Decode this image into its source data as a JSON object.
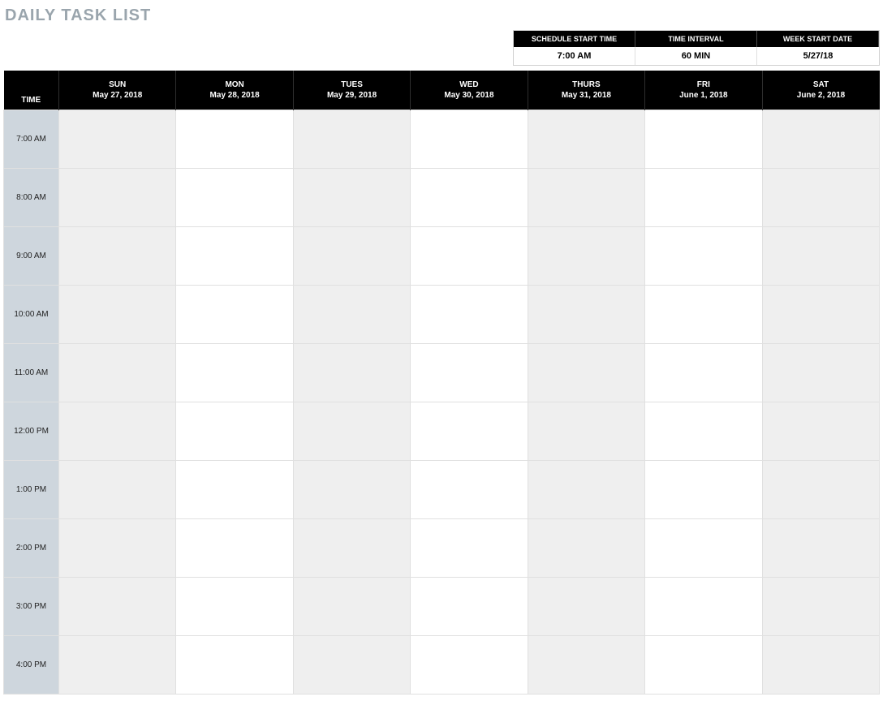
{
  "title": "DAILY TASK LIST",
  "settings": {
    "headers": {
      "start_time": "SCHEDULE START TIME",
      "interval": "TIME INTERVAL",
      "week_start": "WEEK START DATE"
    },
    "values": {
      "start_time": "7:00 AM",
      "interval": "60 MIN",
      "week_start": "5/27/18"
    }
  },
  "schedule": {
    "time_header": "TIME",
    "days": [
      {
        "dow": "SUN",
        "date": "May 27, 2018"
      },
      {
        "dow": "MON",
        "date": "May 28, 2018"
      },
      {
        "dow": "TUES",
        "date": "May 29, 2018"
      },
      {
        "dow": "WED",
        "date": "May 30, 2018"
      },
      {
        "dow": "THURS",
        "date": "May 31, 2018"
      },
      {
        "dow": "FRI",
        "date": "June 1, 2018"
      },
      {
        "dow": "SAT",
        "date": "June 2, 2018"
      }
    ],
    "times": [
      "7:00 AM",
      "8:00 AM",
      "9:00 AM",
      "10:00 AM",
      "11:00 AM",
      "12:00 PM",
      "1:00 PM",
      "2:00 PM",
      "3:00 PM",
      "4:00 PM"
    ]
  }
}
